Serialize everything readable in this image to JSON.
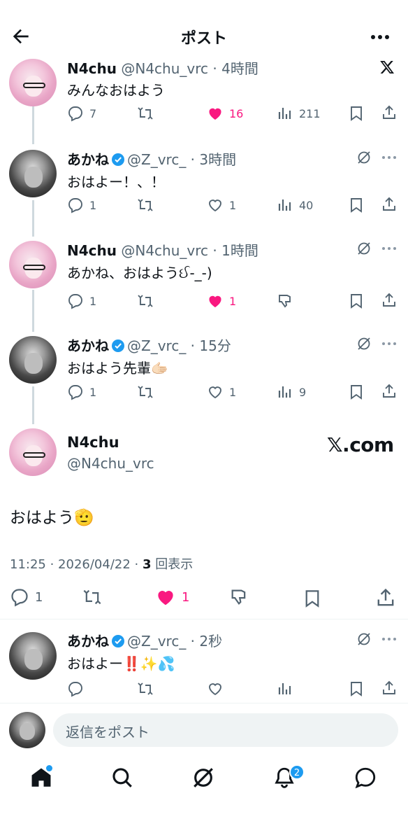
{
  "header": {
    "title": "ポスト"
  },
  "thread": [
    {
      "name": "N4chu",
      "handle": "@N4chu_vrc",
      "time": "4時間",
      "text": "みんなおはよう",
      "replies": "7",
      "likes": "16",
      "views": "211",
      "verified": false,
      "liked": true
    },
    {
      "name": "あかね",
      "handle": "@Z_vrc_",
      "time": "3時間",
      "text": "おはよー！、！",
      "replies": "1",
      "likes": "1",
      "views": "40",
      "verified": true,
      "liked": false
    },
    {
      "name": "N4chu",
      "handle": "@N4chu_vrc",
      "time": "1時間",
      "text": "あかね、おはようઈ-_-)",
      "replies": "1",
      "likes": "1",
      "verified": false,
      "liked": true
    },
    {
      "name": "あかね",
      "handle": "@Z_vrc_",
      "time": "15分",
      "text": "おはよう先輩🫱🏻",
      "replies": "1",
      "likes": "1",
      "views": "9",
      "verified": true,
      "liked": false
    }
  ],
  "main_post": {
    "name": "N4chu",
    "handle": "@N4chu_vrc",
    "source_badge": "𝕏.com",
    "text": "おはよう🫡",
    "timestamp": "11:25 · 2026/04/22 · ",
    "view_count": "3",
    "view_label": " 回表示",
    "replies": "1",
    "likes": "1"
  },
  "reply_post": {
    "name": "あかね",
    "handle": "@Z_vrc_",
    "time": "2秒",
    "text": "おはよー‼️✨💦"
  },
  "reply_bar": {
    "placeholder": "返信をポスト"
  },
  "tabbar": {
    "notification_count": "2"
  },
  "colors": {
    "like_pink": "#f91880",
    "verified_blue": "#1d9bf0",
    "muted": "#536471"
  }
}
